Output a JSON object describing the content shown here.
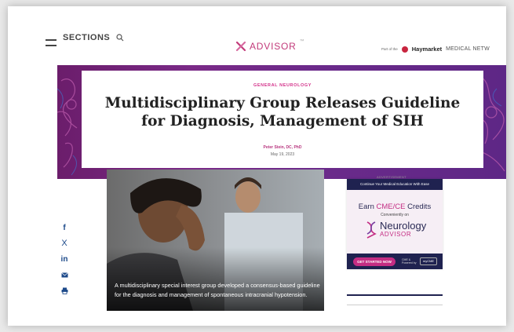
{
  "header": {
    "sections_label": "SECTIONS",
    "brand": "ADVISOR",
    "brand_tm": "™",
    "part_of": "Part of the",
    "haymarket": "Haymarket",
    "haymarket_sub": "MEDICAL NETW"
  },
  "article": {
    "category": "GENERAL NEUROLOGY",
    "headline": "Multidisciplinary Group Releases Guideline for Diagnosis, Management of SIH",
    "author": "Peter Stein, DC, PhD",
    "date": "May 19, 2023",
    "caption": "A multidisciplinary special interest group developed a consensus-based guideline for the diagnosis and management of spontaneous intracranial hypotension."
  },
  "share": {
    "facebook": "f",
    "x": "X",
    "linkedin": "in"
  },
  "ad": {
    "label": "ADVERTISEMENT",
    "top_text": "Continue Your Medical Education With Ease",
    "earn_prefix": "Earn ",
    "earn_highlight": "CME/CE",
    "earn_suffix": " Credits",
    "conveniently": "Conveniently on",
    "logo_name": "Neurology",
    "logo_sub": "ADVISOR",
    "cta": "GET STARTED NOW",
    "cme_line1": "CME &",
    "cme_line2": "Powered by",
    "badge": "myCME"
  },
  "colors": {
    "brand_pink": "#c23a7a",
    "hero_purple": "#6b1d6b",
    "ad_navy": "#1f2250",
    "share_blue": "#1d4a8a"
  }
}
